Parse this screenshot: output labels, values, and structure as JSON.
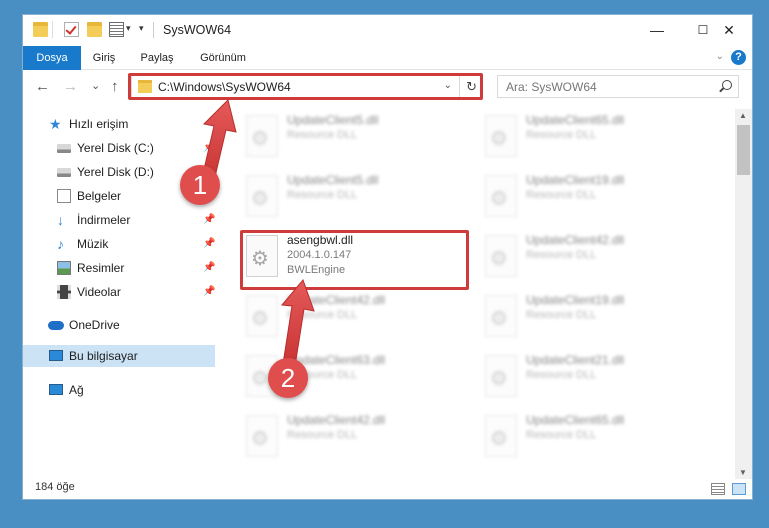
{
  "window": {
    "title": "SysWOW64",
    "controls": {
      "minimize": "—",
      "maximize": "☐",
      "close": "✕"
    }
  },
  "ribbon": {
    "tabs": [
      {
        "label": "Dosya",
        "active": true
      },
      {
        "label": "Giriş",
        "active": false
      },
      {
        "label": "Paylaş",
        "active": false
      },
      {
        "label": "Görünüm",
        "active": false
      }
    ],
    "collapse_icon": "chevron-down-icon",
    "help_icon": "?"
  },
  "address_bar": {
    "path": "C:\\Windows\\SysWOW64",
    "refresh_icon": "↻"
  },
  "search": {
    "placeholder": "Ara: SysWOW64"
  },
  "nav_buttons": {
    "back": "←",
    "forward": "→",
    "recent": "⌄",
    "up": "↑"
  },
  "nav_pane": {
    "items": [
      {
        "label": "Hızlı erişim",
        "icon": "star-icon",
        "pinned": false
      },
      {
        "label": "Yerel Disk (C:)",
        "icon": "drive-icon",
        "pinned": true
      },
      {
        "label": "Yerel Disk (D:)",
        "icon": "drive-icon",
        "pinned": true
      },
      {
        "label": "Belgeler",
        "icon": "documents-icon",
        "pinned": true
      },
      {
        "label": "İndirmeler",
        "icon": "download-icon",
        "pinned": true
      },
      {
        "label": "Müzik",
        "icon": "music-icon",
        "pinned": true
      },
      {
        "label": "Resimler",
        "icon": "pictures-icon",
        "pinned": true
      },
      {
        "label": "Videolar",
        "icon": "video-icon",
        "pinned": true
      },
      {
        "label": "OneDrive",
        "icon": "cloud-icon",
        "pinned": false
      },
      {
        "label": "Bu bilgisayar",
        "icon": "computer-icon",
        "pinned": false,
        "selected": true
      },
      {
        "label": "Ağ",
        "icon": "network-icon",
        "pinned": false
      }
    ]
  },
  "files": {
    "left_column": [
      {
        "name": "UpdateClient5.dll",
        "line2": "Resource DLL",
        "line3": ""
      },
      {
        "name": "UpdateClient5.dll",
        "line2": "Resource DLL",
        "line3": ""
      },
      {
        "name": "asengbwl.dll",
        "line2": "2004.1.0.147",
        "line3": "BWLEngine",
        "highlighted": true
      },
      {
        "name": "UpdateClient42.dll",
        "line2": "Resource DLL",
        "line3": ""
      },
      {
        "name": "UpdateClient63.dll",
        "line2": "Resource DLL",
        "line3": ""
      },
      {
        "name": "UpdateClient42.dll",
        "line2": "Resource DLL",
        "line3": ""
      }
    ],
    "right_column": [
      {
        "name": "UpdateClient65.dll",
        "line2": "Resource DLL"
      },
      {
        "name": "UpdateClient19.dll",
        "line2": "Resource DLL"
      },
      {
        "name": "UpdateClient42.dll",
        "line2": "Resource DLL"
      },
      {
        "name": "UpdateClient19.dll",
        "line2": "Resource DLL"
      },
      {
        "name": "UpdateClient21.dll",
        "line2": "Resource DLL"
      },
      {
        "name": "UpdateClient65.dll",
        "line2": "Resource DLL"
      }
    ]
  },
  "status_bar": {
    "item_count": "184 öğe"
  },
  "annotations": {
    "badge_1": "1",
    "badge_2": "2",
    "color": "#cf3b3b"
  }
}
